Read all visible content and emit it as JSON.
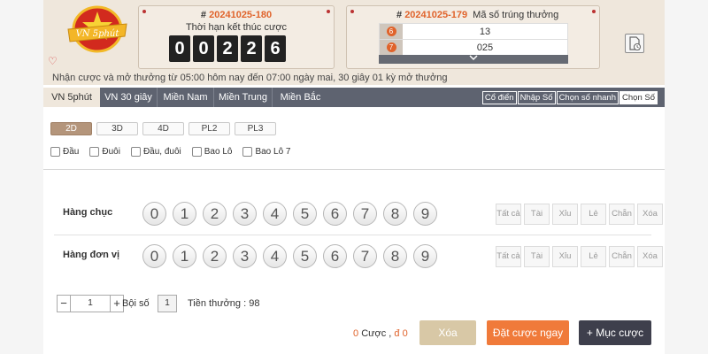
{
  "header": {
    "logo_text": "VN 5phút",
    "current": {
      "issue": "20241025-180",
      "title": "Thời hạn kết thúc cược",
      "countdown": [
        "0",
        "0",
        "2",
        "2",
        "6"
      ]
    },
    "previous": {
      "issue": "20241025-179",
      "label": "Mã số trúng thưởng",
      "results": [
        {
          "badge": "6",
          "value": "13"
        },
        {
          "badge": "7",
          "value": "025"
        }
      ]
    },
    "notice": "Nhận cược và mở thưởng từ 05:00 hôm nay đến 07:00 ngày mai,    30 giây 01 kỳ mở thưởng"
  },
  "tabs": [
    "VN 5phút",
    "VN 30 giây",
    "Miền Nam",
    "Miền Trung",
    "Miền Bắc"
  ],
  "modes": [
    "Cổ điển",
    "Nhập Số",
    "Chọn số nhanh",
    "Chọn Số"
  ],
  "types": [
    "2D",
    "3D",
    "4D",
    "PL2",
    "PL3"
  ],
  "checks": [
    "Đầu",
    "Đuôi",
    "Đầu, đuôi",
    "Bao Lô",
    "Bao Lô 7"
  ],
  "rows": [
    {
      "label": "Hàng chục"
    },
    {
      "label": "Hàng đơn vị"
    }
  ],
  "numbers": [
    "0",
    "1",
    "2",
    "3",
    "4",
    "5",
    "6",
    "7",
    "8",
    "9"
  ],
  "quick": [
    "Tất cả",
    "Tài",
    "Xỉu",
    "Lẻ",
    "Chẵn",
    "Xóa"
  ],
  "footer": {
    "qty": "1",
    "multiplier_label": "Bội số",
    "multiplier": "1",
    "prize_label": "Tiền thưởng :",
    "prize": "98",
    "bets_count": "0",
    "bets_label": "Cược ,",
    "amount_symbol": "đ",
    "amount": "0",
    "clear": "Xóa",
    "bet_now": "Đặt cược ngay",
    "bet_list": "+ Mục cược"
  },
  "colors": {
    "accent": "#e0632b",
    "tabbar": "#5e6370",
    "header_bg": "#efe7dc"
  }
}
